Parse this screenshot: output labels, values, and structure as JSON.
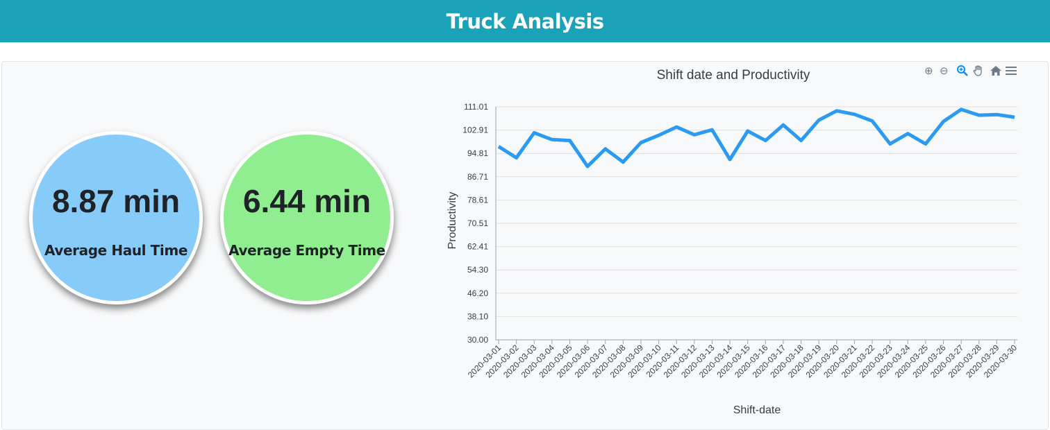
{
  "header": {
    "title": "Truck Analysis"
  },
  "kpis": {
    "haul": {
      "value": "8.87 min",
      "label": "Average Haul Time",
      "color": "#87cbf9"
    },
    "empty": {
      "value": "6.44 min",
      "label": "Average Empty Time",
      "color": "#90ee90"
    }
  },
  "toolbar": {
    "zoom_in_icon": "zoom-in-icon",
    "zoom_out_icon": "zoom-out-icon",
    "selection_zoom_icon": "magnifier-icon",
    "pan_icon": "hand-icon",
    "reset_icon": "home-icon",
    "menu_icon": "hamburger-menu-icon"
  },
  "chart_data": {
    "type": "line",
    "title": "Shift date and Productivity",
    "xlabel": "Shift-date",
    "ylabel": "Productivity",
    "ylim": [
      30.0,
      111.01
    ],
    "yticks": [
      "111.01",
      "102.91",
      "94.81",
      "86.71",
      "78.61",
      "70.51",
      "62.41",
      "54.30",
      "46.20",
      "38.10",
      "30.00"
    ],
    "grid": true,
    "line_color": "#2b9af3",
    "x": [
      "2020-03-01",
      "2020-03-02",
      "2020-03-03",
      "2020-03-04",
      "2020-03-05",
      "2020-03-06",
      "2020-03-07",
      "2020-03-08",
      "2020-03-09",
      "2020-03-10",
      "2020-03-11",
      "2020-03-12",
      "2020-03-13",
      "2020-03-14",
      "2020-03-15",
      "2020-03-16",
      "2020-03-17",
      "2020-03-18",
      "2020-03-19",
      "2020-03-20",
      "2020-03-21",
      "2020-03-22",
      "2020-03-23",
      "2020-03-24",
      "2020-03-25",
      "2020-03-26",
      "2020-03-27",
      "2020-03-28",
      "2020-03-29",
      "2020-03-30"
    ],
    "series": [
      {
        "values": [
          97.2,
          93.3,
          102.0,
          99.6,
          99.3,
          90.3,
          96.4,
          91.8,
          98.6,
          101.1,
          104.0,
          101.3,
          103.0,
          92.7,
          102.6,
          99.3,
          104.7,
          99.3,
          106.4,
          109.6,
          108.4,
          106.1,
          98.1,
          101.7,
          98.1,
          105.9,
          110.1,
          108.1,
          108.3,
          107.4
        ]
      }
    ]
  }
}
